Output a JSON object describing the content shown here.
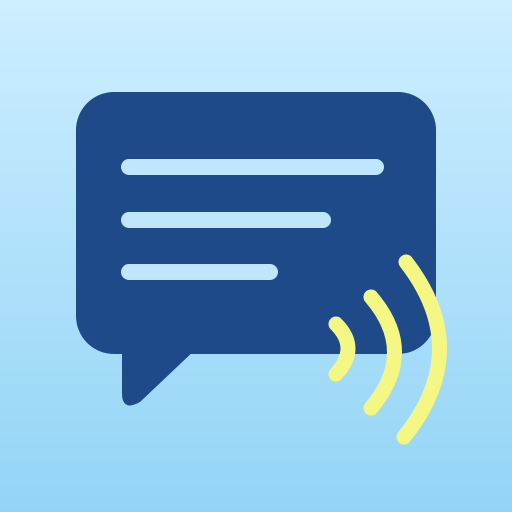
{
  "app_icon": {
    "symbol": "speech-bubble-with-text-lines-and-sound-waves",
    "colors": {
      "background_top": "#cdeeff",
      "background_bottom": "#93d4f6",
      "bubble": "#1f4a8a",
      "text_lines": "#bfe6fb",
      "sound_waves": "#f5f784"
    }
  }
}
